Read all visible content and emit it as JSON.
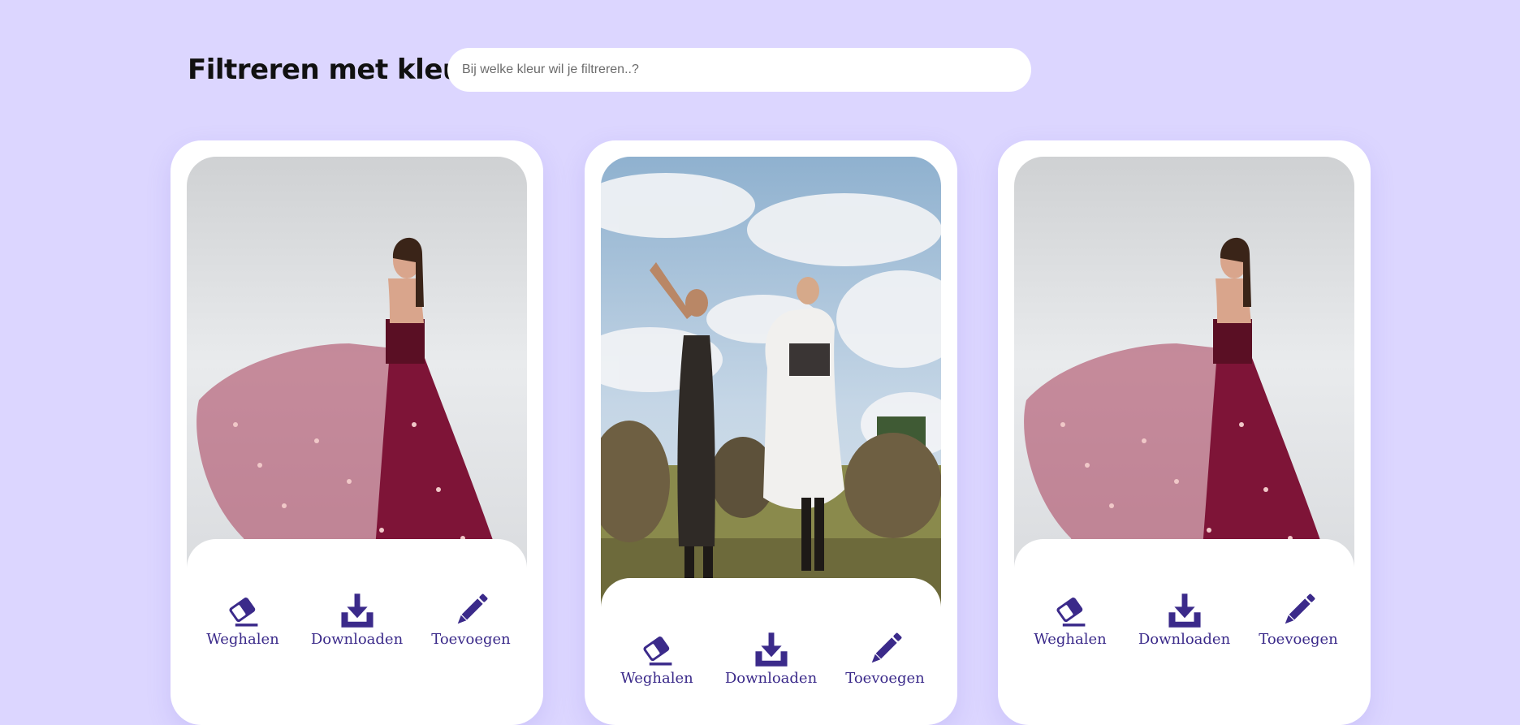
{
  "header": {
    "title": "Filtreren met kleur",
    "search_placeholder": "Bij welke kleur wil je filtreren..?"
  },
  "colors": {
    "background": "#dcd6ff",
    "accent": "#3b2a8a",
    "card": "#ffffff"
  },
  "cards": [
    {
      "photo_icon": "photo-red-gown",
      "actions": [
        {
          "label": "Weghalen",
          "icon": "eraser-icon"
        },
        {
          "label": "Downloaden",
          "icon": "download-icon"
        },
        {
          "label": "Toevoegen",
          "icon": "pencil-icon"
        }
      ]
    },
    {
      "photo_icon": "photo-two-women-field",
      "actions": [
        {
          "label": "Weghalen",
          "icon": "eraser-icon"
        },
        {
          "label": "Downloaden",
          "icon": "download-icon"
        },
        {
          "label": "Toevoegen",
          "icon": "pencil-icon"
        }
      ]
    },
    {
      "photo_icon": "photo-red-gown",
      "actions": [
        {
          "label": "Weghalen",
          "icon": "eraser-icon"
        },
        {
          "label": "Downloaden",
          "icon": "download-icon"
        },
        {
          "label": "Toevoegen",
          "icon": "pencil-icon"
        }
      ]
    }
  ]
}
